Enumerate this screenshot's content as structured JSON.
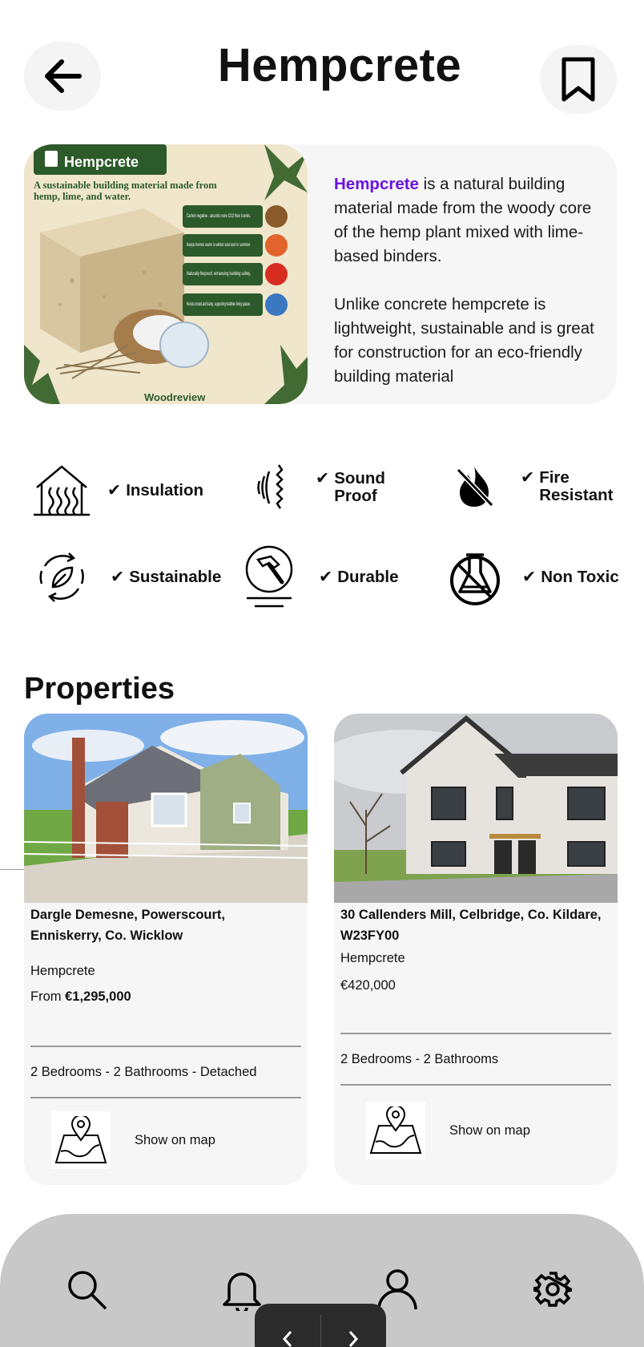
{
  "header": {
    "title": "Hempcrete",
    "back_icon": "arrow-left-icon",
    "bookmark_icon": "bookmark-icon"
  },
  "intro": {
    "image_badge": "Hempcrete",
    "image_tagline": "A sustainable building material made from hemp, lime, and water.",
    "image_bullets": [
      "Carbon negative - absorbs more CO2 than it emits.",
      "Keeps homes warm in winter and cool in summer.",
      "Naturally fireproof, enhancing building safety.",
      "Resists mould and damp, supporting healthier living spaces."
    ],
    "image_watermark": "Woodreview",
    "highlight": "Hempcrete",
    "paragraph1_rest": " is a natural building material made from the woody core of the hemp plant mixed with lime-based binders.",
    "paragraph2": "Unlike concrete hempcrete is lightweight, sustainable and is great for construction for an eco-friendly building material"
  },
  "features": [
    {
      "icon": "house-heat-icon",
      "label": "Insulation"
    },
    {
      "icon": "sound-wave-icon",
      "label": "Sound Proof"
    },
    {
      "icon": "fire-off-icon",
      "label": "Fire Resistant"
    },
    {
      "icon": "recycle-leaf-icon",
      "label": "Sustainable"
    },
    {
      "icon": "hammer-icon",
      "label": "Durable"
    },
    {
      "icon": "flask-off-icon",
      "label": "Non Toxic"
    }
  ],
  "check_mark": "✔",
  "properties": {
    "title": "Properties",
    "items": [
      {
        "address": "Dargle Demesne, Powerscourt, Enniskerry, Co. Wicklow",
        "material": "Hempcrete",
        "price_prefix": "From ",
        "price": "€1,295,000",
        "meta": "2 Bedrooms - 2 Bathrooms - Detached",
        "map_label": "Show on map"
      },
      {
        "address": "30 Callenders Mill, Celbridge, Co. Kildare, W23FY00",
        "material": "Hempcrete",
        "price_prefix": "",
        "price": "€420,000",
        "meta": "2 Bedrooms - 2 Bathrooms",
        "map_label": "Show on map"
      }
    ]
  },
  "nav": {
    "items": [
      "search-icon",
      "bell-icon",
      "user-icon",
      "gear-icon"
    ],
    "pager_prev": "‹",
    "pager_next": "›"
  },
  "colors": {
    "accent": "#6a12e0",
    "card_bg": "#f6f6f6",
    "nav_bg": "#c8c8c8"
  }
}
